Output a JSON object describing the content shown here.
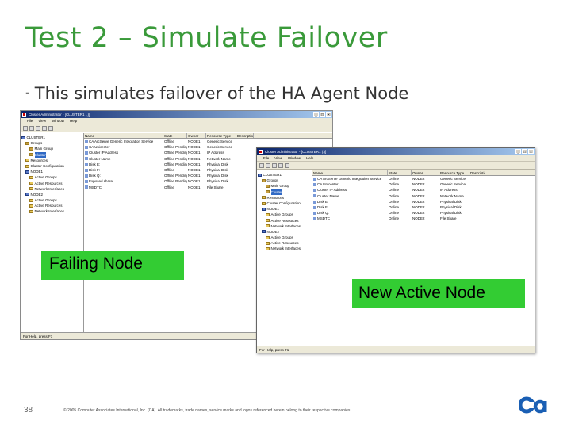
{
  "slide": {
    "title": "Test 2 – Simulate Failover",
    "bullet": "This simulates failover of the HA Agent Node",
    "page_number": "38",
    "copyright": "© 2005 Computer Associates International, Inc. (CA). All trademarks, trade names, service marks and logos referenced herein belong to their respective companies.",
    "logo_icon": "ca-logo-icon",
    "accent_color": "#3a9a3a",
    "label_color": "#33cc33"
  },
  "labels": {
    "failing": "Failing Node",
    "new_active": "New Active Node"
  },
  "window1": {
    "title": "Cluster Administrator - [CLUSTER1 (.)]",
    "menu": [
      "File",
      "View",
      "Window",
      "Help"
    ],
    "tree": [
      "CLUSTER1",
      "Groups",
      "Main Group",
      "Cluster",
      "Resources",
      "Cluster Configuration",
      "NODE1",
      "Active Groups",
      "Active Resources",
      "Network Interfaces",
      "NODE2",
      "Active Groups",
      "Active Resources",
      "Network Interfaces"
    ],
    "columns": [
      "Name",
      "State",
      "Owner",
      "Resource Type",
      "Description"
    ],
    "rows": [
      [
        "CA ArcServe Generic Integration Service",
        "Offline",
        "NODE1",
        "Generic Service",
        ""
      ],
      [
        "CA Unicenter",
        "Offline Pending",
        "NODE1",
        "Generic Service",
        ""
      ],
      [
        "Cluster IP Address",
        "Offline Pending",
        "NODE1",
        "IP Address",
        ""
      ],
      [
        "Cluster Name",
        "Offline Pending",
        "NODE1",
        "Network Name",
        ""
      ],
      [
        "Disk E:",
        "Offline Pending",
        "NODE1",
        "Physical Disk",
        ""
      ],
      [
        "Disk F:",
        "Offline",
        "NODE1",
        "Physical Disk",
        ""
      ],
      [
        "Disk Q:",
        "Offline Pending",
        "NODE1",
        "Physical Disk",
        ""
      ],
      [
        "Exposed share",
        "Offline Pending",
        "NODE1",
        "Physical Disk",
        ""
      ],
      [
        "MSDTC",
        "Offline",
        "NODE1",
        "File Share",
        ""
      ]
    ],
    "status": "For Help, press F1"
  },
  "window2": {
    "title": "Cluster Administrator - [CLUSTER1 (.)]",
    "menu": [
      "File",
      "View",
      "Window",
      "Help"
    ],
    "tree": [
      "CLUSTER1",
      "Groups",
      "Main Group",
      "Cluster",
      "Resources",
      "Cluster Configuration",
      "NODE1",
      "Active Groups",
      "Active Resources",
      "Network Interfaces",
      "NODE2",
      "Active Groups",
      "Active Resources",
      "Network Interfaces"
    ],
    "columns": [
      "Name",
      "State",
      "Owner",
      "Resource Type",
      "Description"
    ],
    "rows": [
      [
        "CA ArcServe Generic Integration Service",
        "Online",
        "NODE2",
        "Generic Service",
        ""
      ],
      [
        "CA Unicenter",
        "Online",
        "NODE2",
        "Generic Service",
        ""
      ],
      [
        "Cluster IP Address",
        "Online",
        "NODE2",
        "IP Address",
        ""
      ],
      [
        "Cluster Name",
        "Online",
        "NODE2",
        "Network Name",
        ""
      ],
      [
        "Disk E:",
        "Online",
        "NODE2",
        "Physical Disk",
        ""
      ],
      [
        "Disk F:",
        "Online",
        "NODE2",
        "Physical Disk",
        ""
      ],
      [
        "Disk Q:",
        "Online",
        "NODE2",
        "Physical Disk",
        ""
      ],
      [
        "MSDTC",
        "Online",
        "NODE2",
        "File Share",
        ""
      ]
    ],
    "status": "For Help, press F1"
  }
}
